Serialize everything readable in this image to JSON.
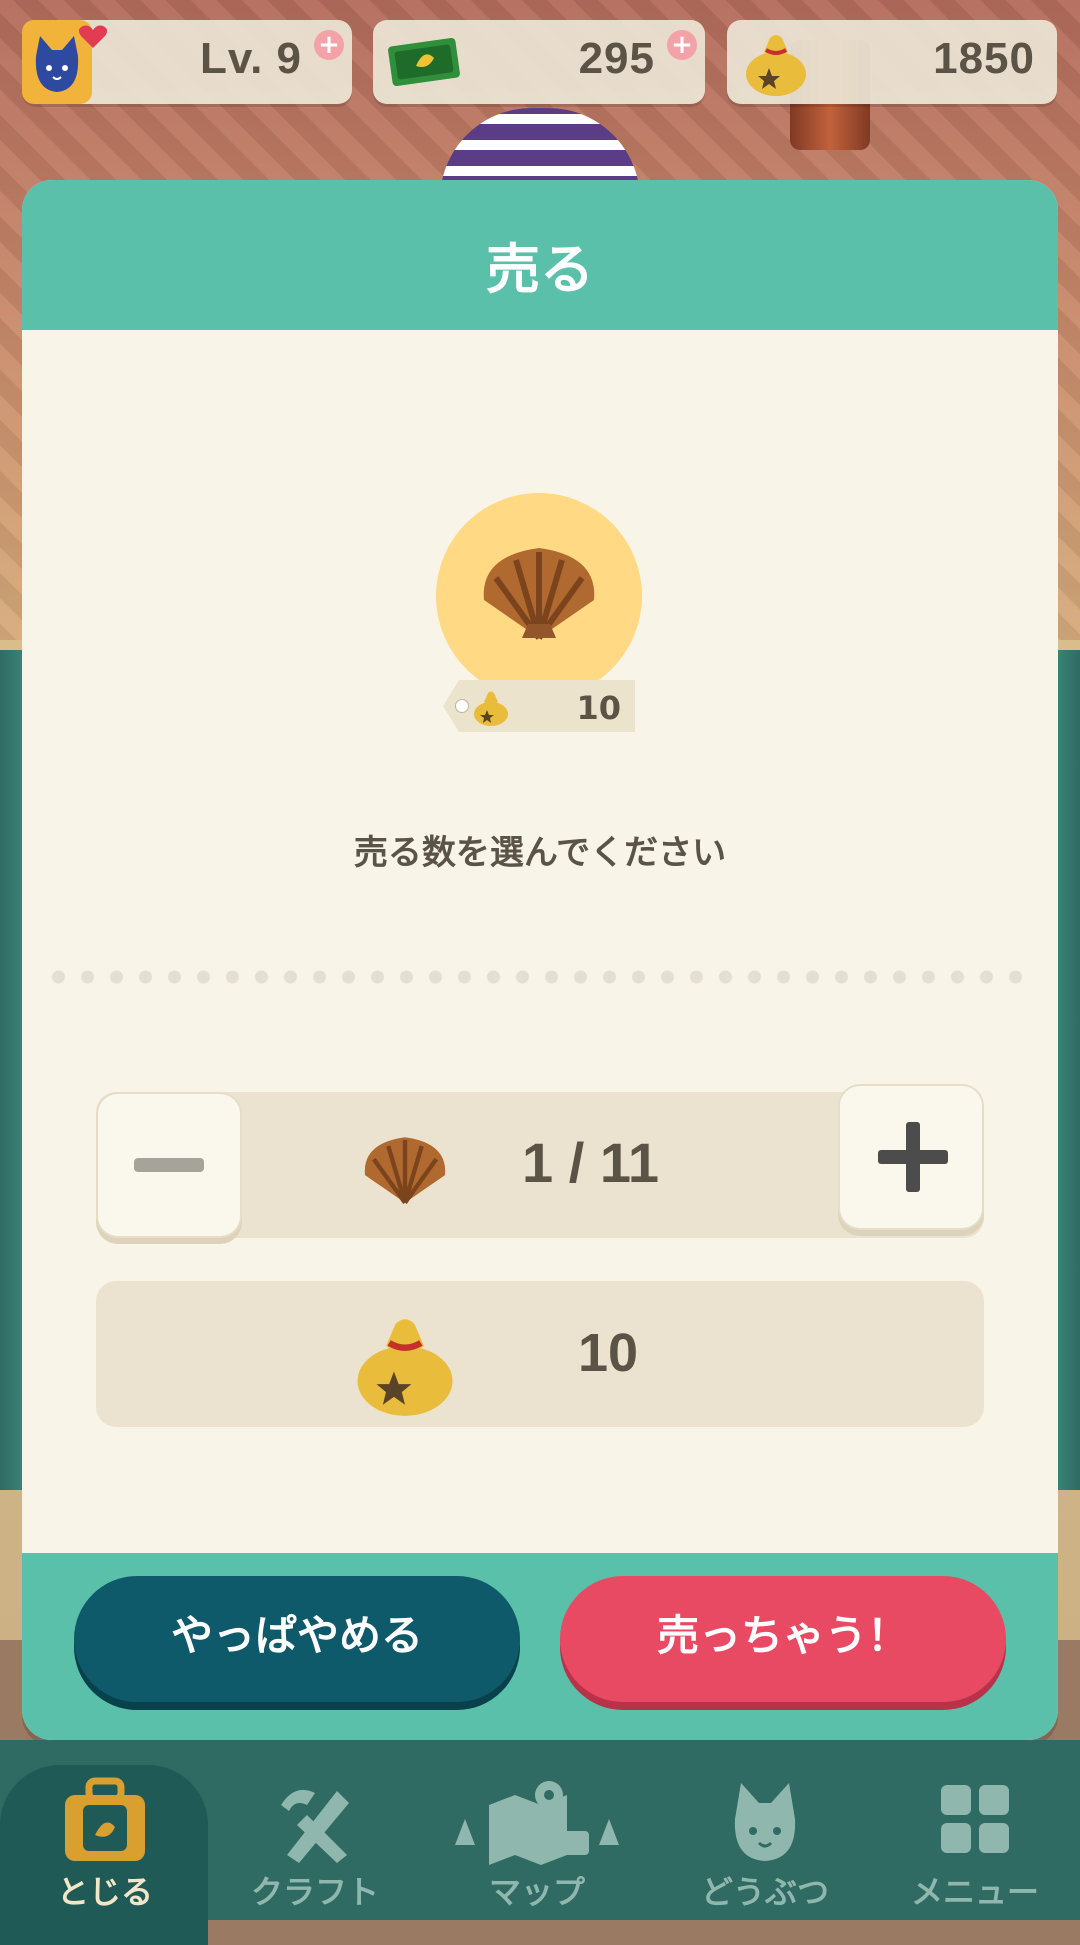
{
  "hud": {
    "level": "Lv. 9",
    "tickets": "295",
    "bells": "1850",
    "plus": "+"
  },
  "dialog": {
    "title": "売る",
    "item_price": "10",
    "prompt": "売る数を選んでください",
    "stepper": {
      "count": "1 / 11",
      "minus_icon": "minus-icon",
      "plus_icon": "plus-icon"
    },
    "total": "10",
    "cancel_label": "やっぱやめる",
    "sell_label": "売っちゃう！"
  },
  "nav": {
    "items": [
      {
        "label": "とじる",
        "icon": "bag-icon",
        "active": true
      },
      {
        "label": "クラフト",
        "icon": "tools-icon",
        "active": false
      },
      {
        "label": "マップ",
        "icon": "map-icon",
        "active": false
      },
      {
        "label": "どうぶつ",
        "icon": "animal-icon",
        "active": false
      },
      {
        "label": "メニュー",
        "icon": "grid-icon",
        "active": false
      }
    ]
  },
  "colors": {
    "header": "#5bc0aa",
    "panel": "#f8f5e8",
    "cancel": "#0e5a6a",
    "sell": "#e84a63",
    "item_circle": "#ffd983"
  }
}
